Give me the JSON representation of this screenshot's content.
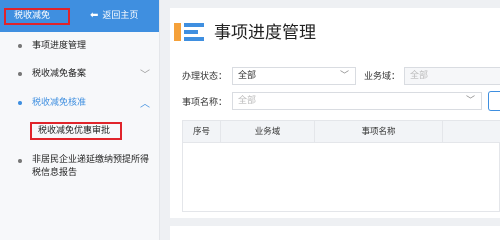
{
  "sidebar": {
    "module_title": "税收减免",
    "back_label": "返回主页",
    "items": [
      {
        "label": "事项进度管理"
      },
      {
        "label": "税收减免备案"
      },
      {
        "label": "税收减免核准"
      },
      {
        "label": "非居民企业递延缴纳预提所得税信息报告"
      }
    ],
    "sub_items": [
      {
        "label": "税收减免优惠审批"
      }
    ]
  },
  "main": {
    "title": "事项进度管理",
    "filters": {
      "status_label": "办理状态：",
      "status_value": "全部",
      "domain_label": "业务域：",
      "domain_value": "全部",
      "item_label": "事项名称：",
      "item_value": "全部"
    },
    "table": {
      "columns": [
        "序号",
        "业务域",
        "事项名称"
      ]
    }
  },
  "colors": {
    "accent": "#3f8fe0",
    "highlight_box": "#e0242b",
    "icon_orange": "#f5a13a"
  }
}
